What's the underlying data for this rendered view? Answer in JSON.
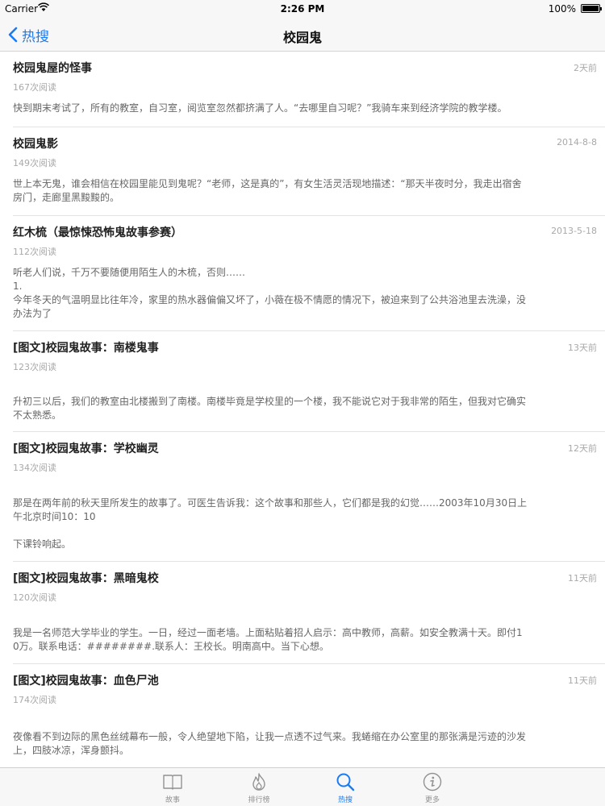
{
  "status_bar": {
    "carrier": "Carrier",
    "time": "2:26 PM",
    "battery": "100%"
  },
  "nav": {
    "back_label": "热搜",
    "title": "校园鬼"
  },
  "stories": [
    {
      "title": "校园鬼屋的怪事",
      "date": "2天前",
      "reads": "167次阅读",
      "excerpt": "快到期末考试了，所有的教室，自习室，阅览室忽然都挤满了人。“去哪里自习呢？”我骑车来到经济学院的教学楼。"
    },
    {
      "title": "校园鬼影",
      "date": "2014-8-8",
      "reads": "149次阅读",
      "excerpt": "世上本无鬼，谁会相信在校园里能见到鬼呢？“老师，这是真的”，有女生活灵活现地描述：“那天半夜时分，我走出宿舍\n房门，走廊里黑黢黢的。"
    },
    {
      "title": "红木梳（最惊悚恐怖鬼故事参赛）",
      "date": "2013-5-18",
      "reads": "112次阅读",
      "excerpt": "听老人们说，千万不要随便用陌生人的木梳，否则……\n1.\n今年冬天的气温明显比往年冷，家里的热水器偏偏又坏了，小薇在极不情愿的情况下，被迫来到了公共浴池里去洗澡，没\n办法为了"
    },
    {
      "title": "[图文]校园鬼故事：南楼鬼事",
      "date": "13天前",
      "reads": "123次阅读",
      "excerpt": "升初三以后，我们的教室由北楼搬到了南楼。南楼毕竟是学校里的一个楼，我不能说它对于我非常的陌生，但我对它确实\n不太熟悉。"
    },
    {
      "title": "[图文]校园鬼故事：学校幽灵",
      "date": "12天前",
      "reads": "134次阅读",
      "excerpt": "那是在两年前的秋天里所发生的故事了。可医生告诉我：这个故事和那些人，它们都是我的幻觉……2003年10月30日上\n午北京时间10：10\n\n下课铃响起。"
    },
    {
      "title": "[图文]校园鬼故事：黑暗鬼校",
      "date": "11天前",
      "reads": "120次阅读",
      "excerpt": "我是一名师范大学毕业的学生。一日，经过一面老墙。上面粘贴着招人启示：高中教师，高薪。如安全教满十天。即付1\n0万。联系电话：########.联系人：王校长。明南高中。当下心想。"
    },
    {
      "title": "[图文]校园鬼故事：血色尸池",
      "date": "11天前",
      "reads": "174次阅读",
      "excerpt": "夜像看不到边际的黑色丝绒幕布一般，令人绝望地下陷，让我一点透不过气来。我蜷缩在办公室里的那张满是污迹的沙发\n上，四肢冰凉，浑身颤抖。"
    }
  ],
  "tabs": [
    {
      "label": "故事",
      "icon": "book-icon",
      "active": false
    },
    {
      "label": "排行榜",
      "icon": "flame-icon",
      "active": false
    },
    {
      "label": "热搜",
      "icon": "search-icon",
      "active": true
    },
    {
      "label": "更多",
      "icon": "info-icon",
      "active": false
    }
  ],
  "colors": {
    "accent": "#1a7cf5",
    "inactive": "#929292",
    "meta": "#a9a9a9"
  }
}
